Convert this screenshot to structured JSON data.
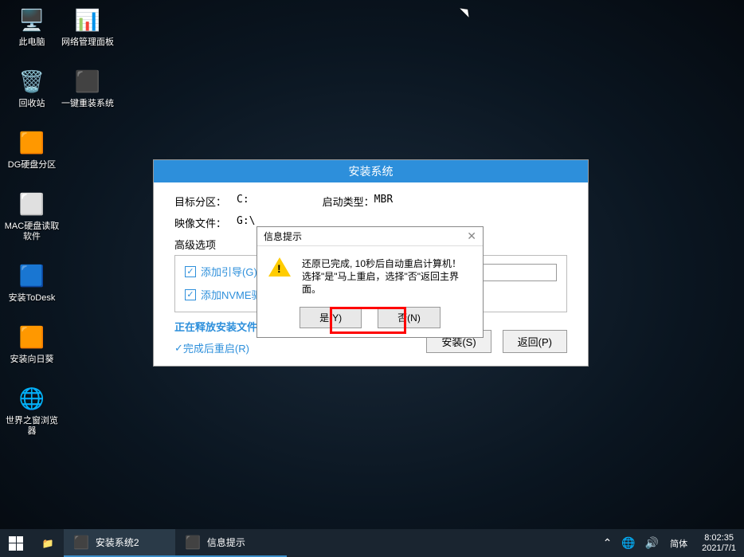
{
  "desktop_icons_col1": [
    {
      "name": "this-pc",
      "label": "此电脑",
      "glyph": "🖥️"
    },
    {
      "name": "recycle-bin",
      "label": "回收站",
      "glyph": "🗑️"
    },
    {
      "name": "dg-partition",
      "label": "DG硬盘分区",
      "glyph": "🟧"
    },
    {
      "name": "mac-disk-reader",
      "label": "MAC硬盘读取软件",
      "glyph": "⬜"
    },
    {
      "name": "install-todesk",
      "label": "安装ToDesk",
      "glyph": "🟦"
    },
    {
      "name": "install-sunflower",
      "label": "安装向日葵",
      "glyph": "🟧"
    },
    {
      "name": "world-browser",
      "label": "世界之窗浏览器",
      "glyph": "🌐"
    }
  ],
  "desktop_icons_col2": [
    {
      "name": "network-panel",
      "label": "网络管理面板",
      "glyph": "📊"
    },
    {
      "name": "one-click-reinstall",
      "label": "一键重装系统",
      "glyph": "⬛"
    }
  ],
  "install_window": {
    "title": "安装系统",
    "target_label": "目标分区：",
    "target_value": "C:",
    "boot_label": "启动类型：",
    "boot_value": "MBR",
    "image_label": "映像文件：",
    "image_value": "G:\\",
    "adv_label": "高级选项",
    "cb_boot": "添加引导(G):",
    "cb_nvme": "添加NVME驱",
    "progress": "正在释放安装文件",
    "cb_reboot": "完成后重启(R)",
    "btn_install": "安装(S)",
    "btn_back": "返回(P)"
  },
  "dialog": {
    "title": "信息提示",
    "msg_line1": "还原已完成, 10秒后自动重启计算机！",
    "msg_line2": "选择\"是\"马上重启，选择\"否\"返回主界面。",
    "btn_yes": "是(Y)",
    "btn_no": "否(N)"
  },
  "taskbar": {
    "task1": "安装系统2",
    "task2": "信息提示",
    "ime": "简体",
    "time": "8:02:35",
    "date": "2021/7/1"
  }
}
